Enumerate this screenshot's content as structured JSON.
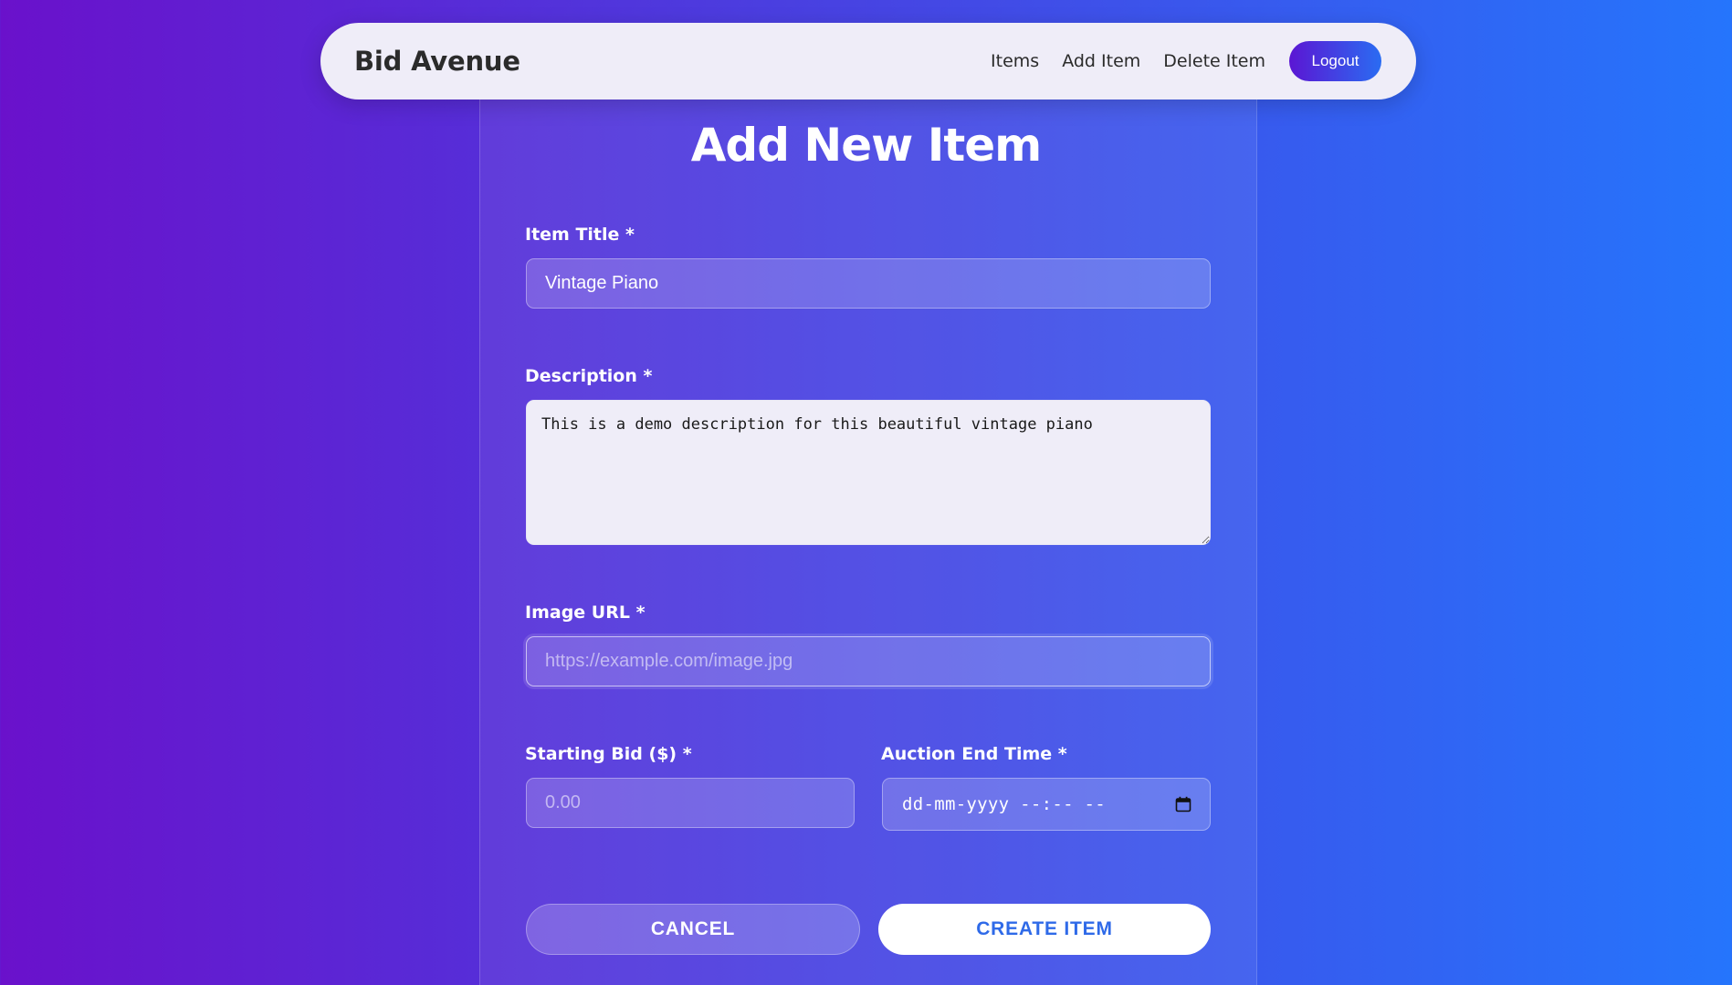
{
  "navbar": {
    "brand": "Bid Avenue",
    "links": [
      "Items",
      "Add Item",
      "Delete Item"
    ],
    "logout_label": "Logout"
  },
  "form": {
    "title": "Add New Item",
    "item_title": {
      "label": "Item Title *",
      "value": "Vintage Piano"
    },
    "description": {
      "label": "Description *",
      "value": "This is a demo description for this beautiful vintage piano"
    },
    "image_url": {
      "label": "Image URL *",
      "placeholder": "https://example.com/image.jpg",
      "value": ""
    },
    "starting_bid": {
      "label": "Starting Bid ($) *",
      "placeholder": "0.00",
      "value": ""
    },
    "auction_end_time": {
      "label": "Auction End Time *",
      "display": "dd-mm-yyyy --:-- --",
      "icon": "calendar-icon"
    },
    "cancel_label": "CANCEL",
    "create_label": "CREATE ITEM"
  },
  "colors": {
    "gradient_start": "#6a11cb",
    "gradient_end": "#2575fc",
    "create_text": "#2f6ae8"
  }
}
